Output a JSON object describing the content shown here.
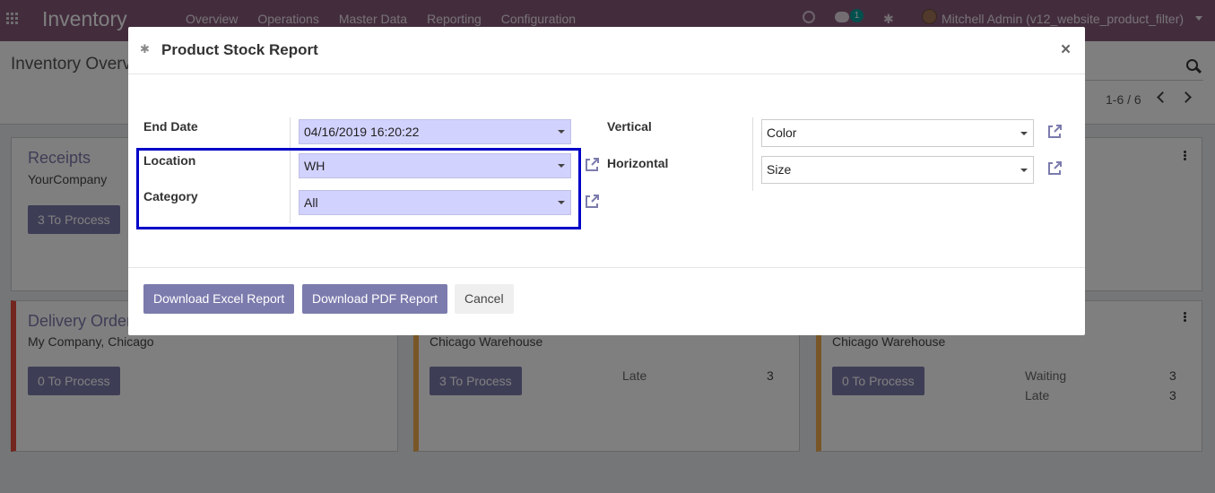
{
  "navbar": {
    "app_name": "Inventory",
    "menu": [
      "Overview",
      "Operations",
      "Master Data",
      "Reporting",
      "Configuration"
    ],
    "chat_count": "1",
    "user": "Mitchell Admin (v12_website_product_filter)"
  },
  "control_panel": {
    "breadcrumb": "Inventory Overview",
    "pager": "1-6 / 6"
  },
  "cards": [
    {
      "title": "Receipts",
      "subtitle": "YourCompany",
      "button": "3 To Process",
      "accent": "#ffffff"
    },
    {
      "title": "Delivery Orders",
      "subtitle": "My Company, Chicago",
      "button": "0 To Process",
      "accent": "#e74c3c"
    },
    {
      "title": "",
      "subtitle": "Chicago Warehouse",
      "button": "3 To Process",
      "accent": "#f0ad4e",
      "stats": [
        {
          "label": "Late",
          "value": "3"
        }
      ]
    },
    {
      "title": "",
      "subtitle": "Chicago Warehouse",
      "button": "0 To Process",
      "accent": "#f0ad4e",
      "stats": [
        {
          "label": "Waiting",
          "value": "3"
        },
        {
          "label": "Late",
          "value": "3"
        }
      ]
    }
  ],
  "modal": {
    "title": "Product Stock Report",
    "fields": {
      "end_date": {
        "label": "End Date",
        "value": "04/16/2019 16:20:22"
      },
      "location": {
        "label": "Location",
        "value": "WH"
      },
      "category": {
        "label": "Category",
        "value": "All"
      },
      "vertical": {
        "label": "Vertical",
        "value": "Color"
      },
      "horizontal": {
        "label": "Horizontal",
        "value": "Size"
      }
    },
    "buttons": {
      "excel": "Download Excel Report",
      "pdf": "Download PDF Report",
      "cancel": "Cancel"
    }
  },
  "colors": {
    "brand": "#875a7b",
    "primary": "#7c7bad",
    "required_field": "#d2d2ff",
    "highlight_box": "#0000c8"
  }
}
